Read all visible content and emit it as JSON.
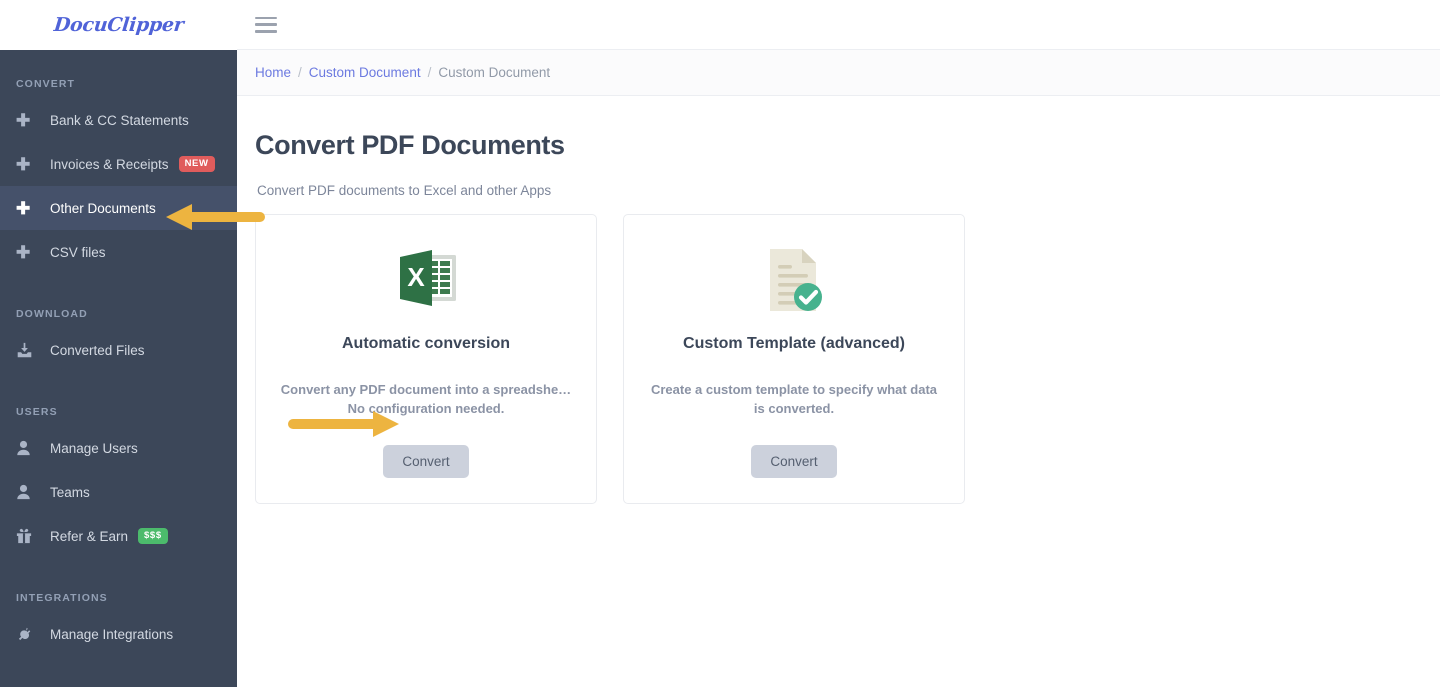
{
  "brand": {
    "name": "DocuClipper",
    "color": "#5063d8"
  },
  "topbar": {
    "menu_icon": "hamburger-icon"
  },
  "breadcrumb": {
    "items": [
      {
        "label": "Home",
        "type": "link"
      },
      {
        "label": "Custom Document",
        "type": "link"
      },
      {
        "label": "Custom Document",
        "type": "current"
      }
    ],
    "separator": "/"
  },
  "sidebar": {
    "sections": [
      {
        "label": "CONVERT",
        "items": [
          {
            "label": "Bank & CC Statements",
            "icon": "plus-icon",
            "active": false,
            "badge": null
          },
          {
            "label": "Invoices & Receipts",
            "icon": "plus-icon",
            "active": false,
            "badge": "NEW",
            "badge_color": "#e05c5c"
          },
          {
            "label": "Other Documents",
            "icon": "plus-icon",
            "active": true,
            "badge": null
          },
          {
            "label": "CSV files",
            "icon": "plus-icon",
            "active": false,
            "badge": null
          }
        ]
      },
      {
        "label": "DOWNLOAD",
        "items": [
          {
            "label": "Converted Files",
            "icon": "download-inbox-icon",
            "active": false,
            "badge": null
          }
        ]
      },
      {
        "label": "USERS",
        "items": [
          {
            "label": "Manage Users",
            "icon": "user-icon",
            "active": false,
            "badge": null
          },
          {
            "label": "Teams",
            "icon": "user-icon",
            "active": false,
            "badge": null
          },
          {
            "label": "Refer & Earn",
            "icon": "gift-icon",
            "active": false,
            "badge": "$$$",
            "badge_color": "#4cbb6c"
          }
        ]
      },
      {
        "label": "INTEGRATIONS",
        "items": [
          {
            "label": "Manage Integrations",
            "icon": "plug-icon",
            "active": false,
            "badge": null
          }
        ]
      }
    ]
  },
  "main": {
    "title": "Convert PDF Documents",
    "subtitle": "Convert PDF documents to Excel and other Apps",
    "cards": [
      {
        "icon": "excel-file-icon",
        "title": "Automatic conversion",
        "description": "Convert any PDF document into a spreadshe… No configuration needed.",
        "button_label": "Convert"
      },
      {
        "icon": "document-check-icon",
        "title": "Custom Template (advanced)",
        "description": "Create a custom template to specify what data is converted.",
        "button_label": "Convert"
      }
    ]
  },
  "annotations": {
    "arrows": [
      {
        "name": "arrow-pointing-other-documents",
        "direction": "left",
        "color": "#edb440"
      },
      {
        "name": "arrow-pointing-convert-button",
        "direction": "right",
        "color": "#edb440"
      }
    ]
  },
  "colors": {
    "sidebar_bg": "#3c4759",
    "sidebar_active": "#45516a",
    "link": "#6c7ae0",
    "heading": "#3c4759",
    "button_bg": "#ccd1dc",
    "annotation": "#edb440"
  }
}
